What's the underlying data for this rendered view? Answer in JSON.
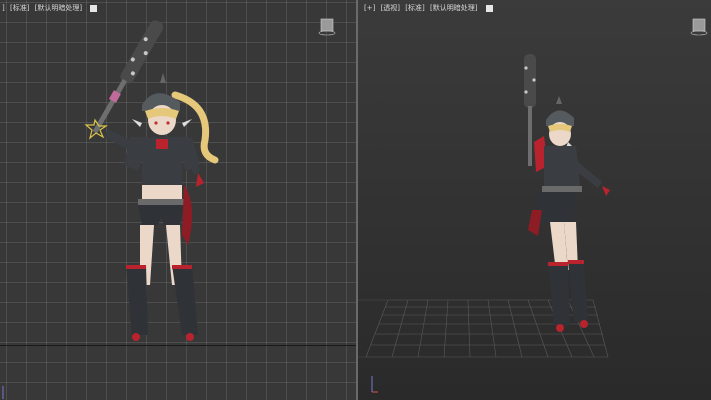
{
  "left_viewport": {
    "menu_items": [
      "+",
      "[标准]",
      "[默认明暗处理]"
    ],
    "partial_prefix": "]"
  },
  "right_viewport": {
    "menu_items": [
      "[+]",
      "[透视]",
      "[标准]",
      "[默认明暗处理]"
    ]
  },
  "colors": {
    "viewport_bg_front": "#383838",
    "viewport_bg_persp": "#333333",
    "grid_line": "#505050",
    "armor": "#3a3d42",
    "accent_red": "#b8232e",
    "skin": "#e9d3c4",
    "hair": "#e5c87a"
  },
  "icons": [
    "viewcube-icon",
    "axis-gizmo-icon",
    "character-model",
    "grid-floor"
  ]
}
